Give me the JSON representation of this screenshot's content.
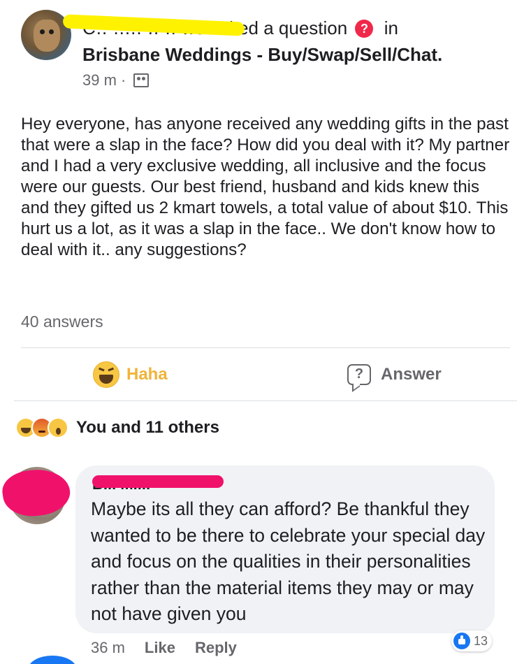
{
  "post": {
    "author_masked": "C.. ..... .. ..",
    "action_prefix": "we",
    "action_text": "asked a question",
    "in_text": "in",
    "question_icon": "question-mark-icon",
    "group_name": "Brisbane Weddings - Buy/Swap/Sell/Chat.",
    "time": "39 m",
    "audience_icon": "group-members-icon",
    "body": "Hey everyone, has anyone received any wedding gifts in the past that were a slap in the face? How did you deal with it? My partner and I had a very exclusive wedding, all inclusive and the focus were our guests. Our best friend, husband and kids knew this and they gifted us 2 kmart towels, a total value of about $10. This hurt us a lot, as it was a slap in the face.. We don't know how to deal with it.. any suggestions?",
    "answers_count": "40 answers"
  },
  "actions": {
    "haha_label": "Haha",
    "answer_label": "Answer",
    "haha_color": "#f0b33a"
  },
  "reactions": {
    "icons": [
      "haha-icon",
      "angry-icon",
      "wow-icon"
    ],
    "summary": "You and 11 others"
  },
  "comment": {
    "author_masked": "B... M....",
    "text": "Maybe its all they can afford? Be thankful they wanted to be there to celebrate your special day and focus on the qualities in their personalities rather than the material items they may or may not have given you",
    "time": "36 m",
    "like_label": "Like",
    "reply_label": "Reply",
    "like_count": "13"
  },
  "colors": {
    "redaction_yellow": "#fff200",
    "redaction_pink": "#f0116b",
    "like_blue": "#1877f2",
    "meta_gray": "#65676b"
  }
}
